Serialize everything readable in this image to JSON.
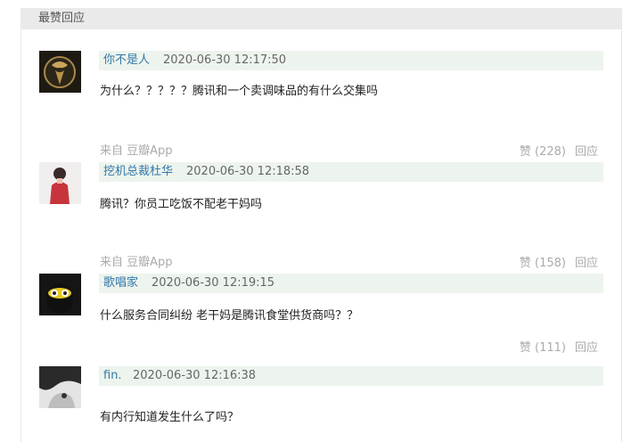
{
  "section": {
    "title": "最赞回应"
  },
  "comments": [
    {
      "author": "你不是人",
      "time": "2020-06-30 12:17:50",
      "text": "为什么？？？？？腾讯和一个卖调味品的有什么交集吗",
      "source": "来自 豆瓣App",
      "like_label": "赞 (228)",
      "reply_label": "回应"
    },
    {
      "author": "挖机总裁杜华",
      "time": "2020-06-30 12:18:58",
      "text": "腾讯？你员工吃饭不配老干妈吗",
      "source": "来自 豆瓣App",
      "like_label": "赞 (158)",
      "reply_label": "回应"
    },
    {
      "author": "歌唱家",
      "time": "2020-06-30 12:19:15",
      "text": "什么服务合同纠纷 老干妈是腾讯食堂供货商吗？？",
      "like_label": "赞 (111)",
      "reply_label": "回应"
    },
    {
      "author": "fin.",
      "time": "2020-06-30 12:16:38",
      "text": "有内行知道发生什么了吗？"
    }
  ]
}
